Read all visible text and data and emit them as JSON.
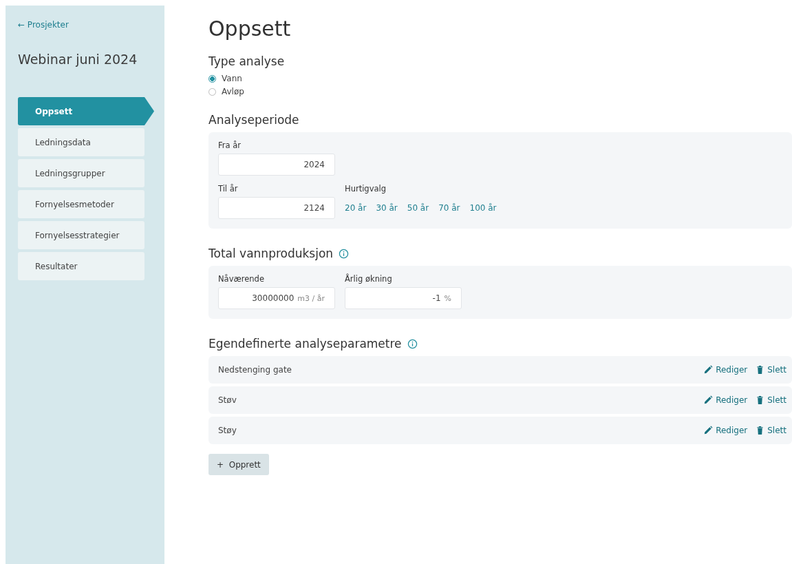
{
  "sidebar": {
    "back_link": {
      "icon": "←",
      "label": "Prosjekter"
    },
    "project_title": "Webinar juni 2024",
    "items": [
      {
        "label": "Oppsett",
        "selected": true
      },
      {
        "label": "Ledningsdata",
        "selected": false
      },
      {
        "label": "Ledningsgrupper",
        "selected": false
      },
      {
        "label": "Fornyelsesmetoder",
        "selected": false
      },
      {
        "label": "Fornyelsesstrategier",
        "selected": false
      },
      {
        "label": "Resultater",
        "selected": false
      }
    ]
  },
  "page_title": "Oppsett",
  "type_analyse": {
    "heading": "Type analyse",
    "options": [
      {
        "label": "Vann",
        "selected": true
      },
      {
        "label": "Avløp",
        "selected": false
      }
    ]
  },
  "analyseperiode": {
    "heading": "Analyseperiode",
    "from": {
      "label": "Fra år",
      "value": "2024"
    },
    "to": {
      "label": "Til år",
      "value": "2124"
    },
    "quick": {
      "label": "Hurtigvalg",
      "options": [
        "20 år",
        "30 år",
        "50 år",
        "70 år",
        "100 år"
      ]
    }
  },
  "vannproduksjon": {
    "heading": "Total vannproduksjon",
    "current": {
      "label": "Nåværende",
      "value": "30000000",
      "unit": "m3 / år"
    },
    "growth": {
      "label": "Årlig økning",
      "value": "-1",
      "unit": "%"
    }
  },
  "parametre": {
    "heading": "Egendefinerte analyseparametre",
    "rows": [
      {
        "name": "Nedstenging gate",
        "edit": "Rediger",
        "delete": "Slett"
      },
      {
        "name": "Støv",
        "edit": "Rediger",
        "delete": "Slett"
      },
      {
        "name": "Støy",
        "edit": "Rediger",
        "delete": "Slett"
      }
    ],
    "create_button": {
      "icon": "+",
      "label": "Opprett"
    }
  }
}
